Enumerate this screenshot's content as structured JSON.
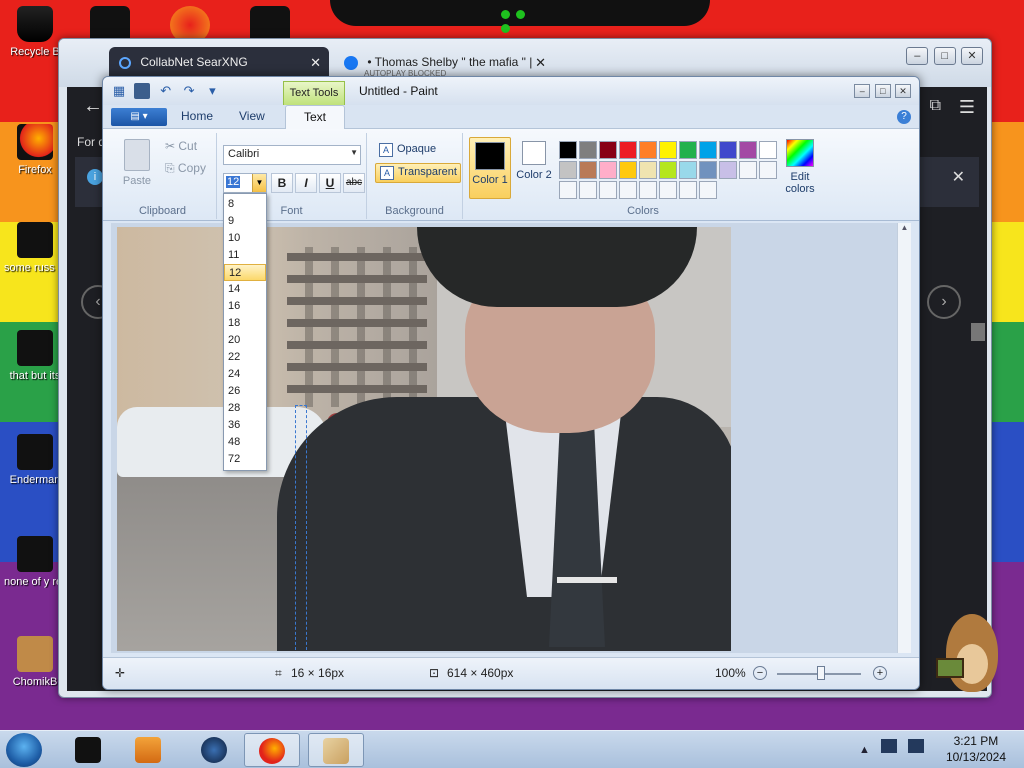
{
  "desktop": {
    "icons": [
      {
        "label": "Recycle B"
      },
      {
        "label": "Firefox"
      },
      {
        "label": "some russ ran a ra"
      },
      {
        "label": "that but its"
      },
      {
        "label": "Enderman"
      },
      {
        "label": "none of y retards kn"
      },
      {
        "label": "ChomikB"
      }
    ]
  },
  "browser": {
    "tabs": [
      {
        "label": "CollabNet SearXNG",
        "close": "✕"
      },
      {
        "label": "• Thomas Shelby \" the mafia \" |",
        "sub": "AUTOPLAY BLOCKED",
        "close": "✕"
      }
    ],
    "controls": [
      "–",
      "□",
      "✕"
    ],
    "back": "←",
    "for_text": "For q",
    "info_icon": "i",
    "info_close": "✕",
    "prev": "‹",
    "next": "›",
    "menu": "☰",
    "ext": "⧉"
  },
  "paint": {
    "title": "Untitled - Paint",
    "context_tab": "Text Tools",
    "controls": [
      "–",
      "□",
      "✕"
    ],
    "file_menu": "▤ ▾",
    "tabs": {
      "home": "Home",
      "view": "View",
      "text": "Text"
    },
    "help": "?",
    "clipboard": {
      "paste": "Paste",
      "cut": "✂ Cut",
      "copy": "⎘ Copy",
      "title": "Clipboard"
    },
    "font": {
      "name": "Calibri",
      "size": "12",
      "bold": "B",
      "italic": "I",
      "underline": "U",
      "strike": "abc",
      "title": "Font"
    },
    "background": {
      "opaque": "Opaque",
      "transparent": "Transparent",
      "title": "Background"
    },
    "colors": {
      "color1": "Color 1",
      "color2": "Color 2",
      "edit": "Edit colors",
      "title": "Colors",
      "palette_row1": [
        "#000000",
        "#7f7f7f",
        "#880015",
        "#ed1c24",
        "#ff7f27",
        "#fff200",
        "#22b14c",
        "#00a2e8",
        "#3f48cc",
        "#a349a4"
      ],
      "palette_row2": [
        "#ffffff",
        "#c3c3c3",
        "#b97a57",
        "#ffaec9",
        "#ffc90e",
        "#efe4b0",
        "#b5e61d",
        "#99d9ea",
        "#7092be",
        "#c8bfe7"
      ]
    },
    "size_list": [
      "8",
      "9",
      "10",
      "11",
      "12",
      "14",
      "16",
      "18",
      "20",
      "22",
      "24",
      "26",
      "28",
      "36",
      "48",
      "72"
    ],
    "size_highlight": "12",
    "status": {
      "move_icon": "✛",
      "selection": "16 × 16px",
      "image_size": "614 × 460px",
      "zoom": "100%",
      "zoom_out": "−",
      "zoom_in": "+"
    }
  },
  "taskbar": {
    "time": "3:21 PM",
    "date": "10/13/2024"
  }
}
